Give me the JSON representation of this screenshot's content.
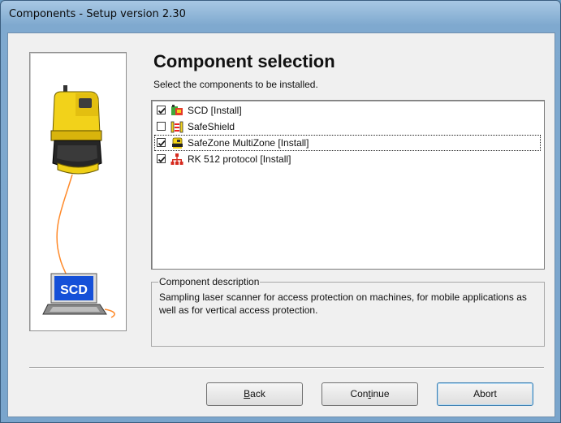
{
  "window": {
    "title": "Components - Setup version 2.30"
  },
  "illustration": {
    "monitor_text": "SCD"
  },
  "header": {
    "title": "Component selection",
    "subtitle": "Select the components to be installed."
  },
  "components": [
    {
      "label": "SCD  [Install]",
      "checked": true,
      "icon": "scanner-device-icon"
    },
    {
      "label": "SafeShield",
      "checked": false,
      "icon": "safeshield-icon"
    },
    {
      "label": "SafeZone MultiZone  [Install]",
      "checked": true,
      "icon": "safezone-scanner-icon",
      "focused": true
    },
    {
      "label": "RK 512 protocol  [Install]",
      "checked": true,
      "icon": "network-protocol-icon"
    }
  ],
  "description": {
    "legend": "Component description",
    "text": "Sampling laser scanner for access protection on machines, for mobile applications as well as for vertical access protection."
  },
  "buttons": {
    "back_mnemonic": "B",
    "back_rest": "ack",
    "continue_pre": "Con",
    "continue_mnemonic": "t",
    "continue_post": "inue",
    "abort": "Abort"
  }
}
